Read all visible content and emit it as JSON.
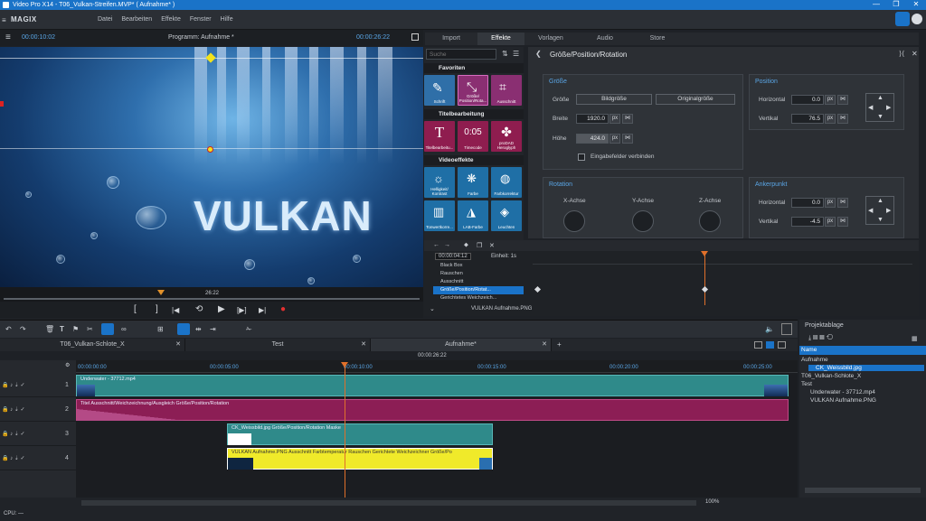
{
  "window": {
    "title": "Video Pro X14 - T06_Vulkan-Streifen.MVP* ( Aufnahme* )",
    "minimize": "—",
    "maximize": "❐",
    "close": "✕"
  },
  "app": {
    "logo": "MAGIX",
    "menu": [
      "Datei",
      "Bearbeiten",
      "Effekte",
      "Fenster",
      "Hilfe"
    ]
  },
  "preview": {
    "time_left": "00:00:10:02",
    "program_label": "Programm: Aufnahme *",
    "time_right": "00:00:26:22",
    "scrub_time": "26:22",
    "overlay_text": "VULKAN"
  },
  "transport": {
    "mark_in": "[",
    "mark_out": "]",
    "prev_marker": "|◀",
    "loop": "⟲",
    "play": "▶",
    "next_frame": "[▶]",
    "next_marker": "▶|",
    "record": "●"
  },
  "effects": {
    "tabs": [
      "Import",
      "Effekte",
      "Vorlagen",
      "Audio",
      "Store"
    ],
    "active_tab": "Effekte",
    "search_placeholder": "Suche",
    "groups": [
      {
        "name": "Favoriten",
        "tiles": [
          {
            "label": "Schrift"
          },
          {
            "label": "Größe/ Position/Rota..."
          },
          {
            "label": "Ausschnitt"
          }
        ]
      },
      {
        "name": "Titelbearbeitung",
        "tiles": [
          {
            "label": "Titelbearbeitu...",
            "glyph": "T"
          },
          {
            "label": "Timecode",
            "glyph": "0:05"
          },
          {
            "label": "proDAD Heroglyph",
            "glyph": "✤"
          }
        ]
      },
      {
        "name": "Videoeffekte",
        "tiles": [
          {
            "label": "Helligkeit/ Kontrast"
          },
          {
            "label": "Farbe"
          },
          {
            "label": "Farbkorrektur"
          },
          {
            "label": "Tonwertkorre..."
          },
          {
            "label": "LAB-Farbe"
          },
          {
            "label": "Leuchten"
          }
        ]
      }
    ],
    "panel_title": "Größe/Position/Rotation",
    "size": {
      "title": "Größe",
      "size_label": "Größe",
      "fill_btn": "Bildgröße",
      "orig_btn": "Originalgröße",
      "width_label": "Breite",
      "width": "1920.0",
      "height_label": "Höhe",
      "height": "424.0",
      "unit": "px",
      "link_label": "Eingabefelder verbinden"
    },
    "position": {
      "title": "Position",
      "h_label": "Horizontal",
      "h": "0.0",
      "v_label": "Vertikal",
      "v": "76.5",
      "unit": "px"
    },
    "rotation": {
      "title": "Rotation",
      "x": "X-Achse",
      "y": "Y-Achse",
      "z": "Z-Achse"
    },
    "anchor": {
      "title": "Ankerpunkt",
      "h_label": "Horizontal",
      "h": "0.0",
      "v_label": "Vertikal",
      "v": "-4.5",
      "unit": "px"
    }
  },
  "keyframes": {
    "time": "00:00:04:12",
    "unit_label": "Einheit: 1s",
    "rows": [
      "Black Box",
      "Rauschen",
      "Ausschnitt",
      "Größe/Position/Rotat...",
      "Gerichtetes Weichzeich..."
    ],
    "active_row": "Größe/Position/Rotat...",
    "file": "VULKAN Aufnahme.PNG"
  },
  "timeline": {
    "tabs": [
      {
        "label": "T06_Vulkan-Schlote_X",
        "close": "✕"
      },
      {
        "label": "Test",
        "close": "✕"
      },
      {
        "label": "Aufnahme*",
        "close": "✕"
      }
    ],
    "add_tab": "+",
    "time_center": "00:00:26:22",
    "ruler": [
      "00:00:00:00",
      "00:00:05:00",
      "00:00:10:00",
      "00:00:15:00",
      "00:00:20:00",
      "00:00:25:00"
    ],
    "tracks": [
      "1",
      "2",
      "3",
      "4"
    ],
    "clips": {
      "underwater": "Underwater - 37712.mp4",
      "pink": "Titel  Ausschnitt/Weichzeichnung/Ausgleich  Größe/Position/Rotation",
      "weiss": "CK_Weissbild.jpg  Größe/Position/Rotation  Maske",
      "yellow": "VULKAN Aufnahme.PNG  Ausschnitt  Farbtemperatur  Rauschen  Gerichtete Weichzeichner  Größe/Po"
    },
    "zoom": "100%"
  },
  "project": {
    "title": "Projektablage",
    "col": "Name",
    "items": [
      {
        "name": "Aufnahme",
        "indent": 0
      },
      {
        "name": "CK_Weissbild.jpg",
        "indent": 1,
        "selected": true
      },
      {
        "name": "T06_Vulkan-Schlote_X",
        "indent": 0
      },
      {
        "name": "Test",
        "indent": 0
      },
      {
        "name": "Underwater - 37712.mp4",
        "indent": 1
      },
      {
        "name": "VULKAN Aufnahme.PNG",
        "indent": 1
      }
    ]
  },
  "status": {
    "cpu": "CPU: —"
  }
}
